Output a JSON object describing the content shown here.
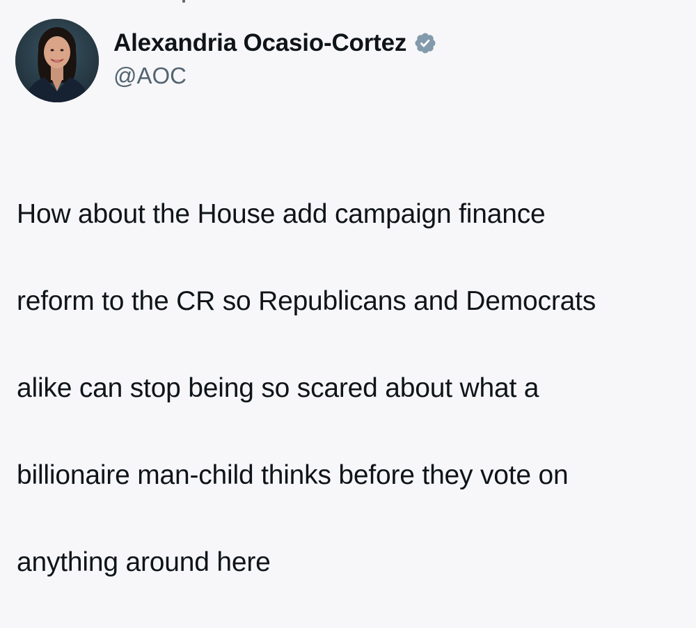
{
  "author": {
    "display_name": "Alexandria Ocasio-Cortez",
    "handle": "@AOC",
    "verified": true,
    "verified_badge_color": "#829aab",
    "avatar": "profile-photo"
  },
  "tweet": {
    "lines": [
      "How about the House add campaign finance",
      "reform to the CR so Republicans and Democrats",
      "alike can stop being so scared about what a",
      "billionaire man-child thinks before they vote on",
      "anything around here"
    ]
  },
  "colors": {
    "background": "#f7f7f9",
    "text": "#0f1419",
    "secondary_text": "#536471"
  }
}
